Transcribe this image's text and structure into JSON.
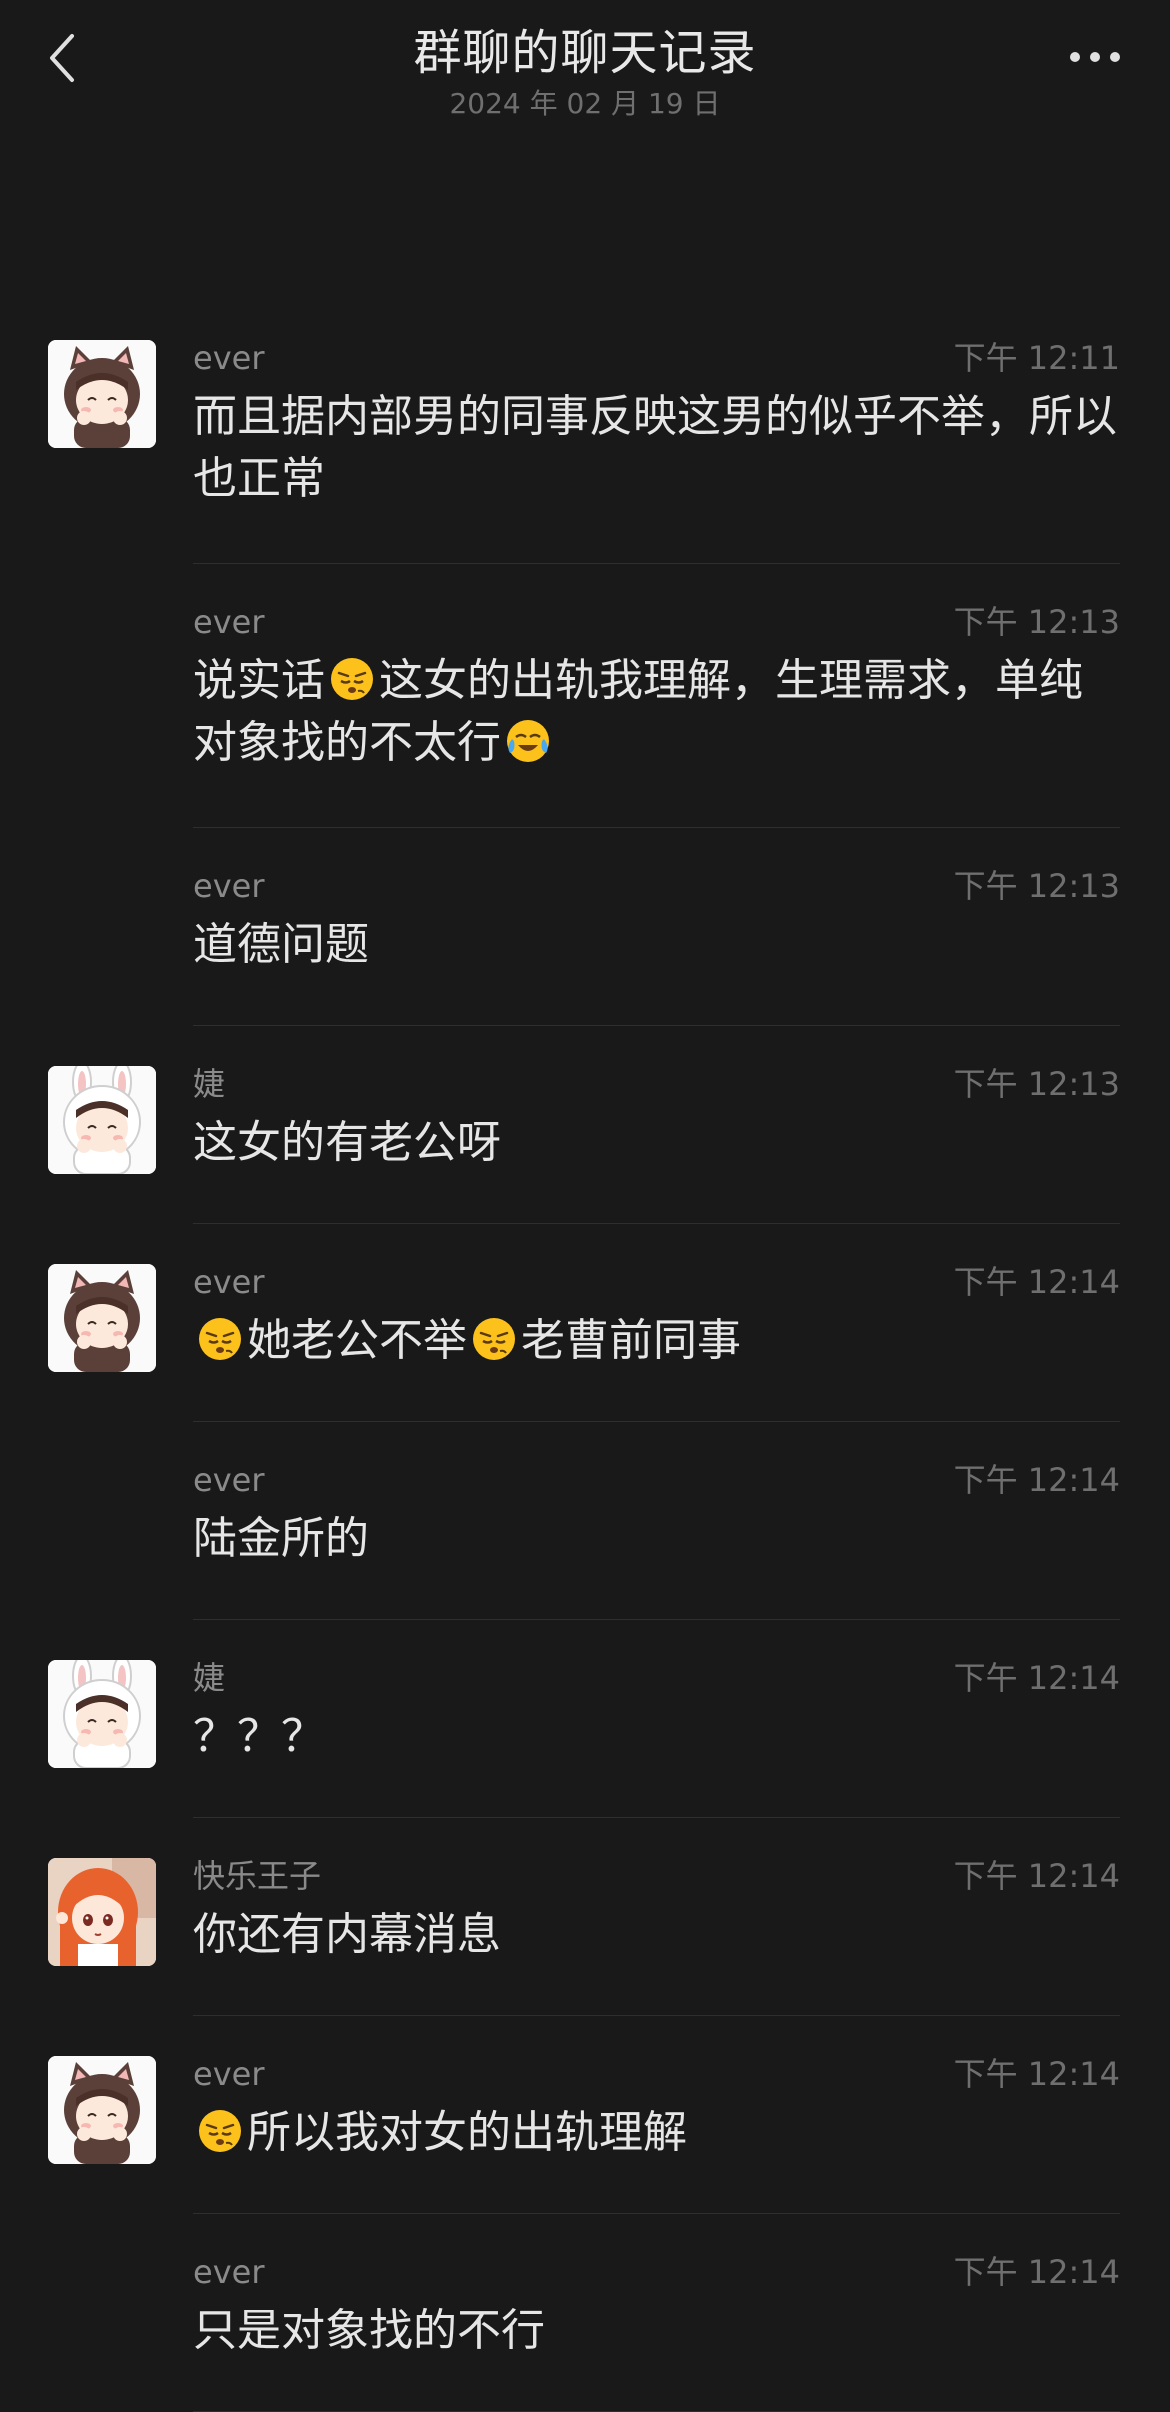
{
  "header": {
    "back_icon": "chevron-left-icon",
    "title": "群聊的聊天记录",
    "date": "2024 年 02 月 19 日",
    "more_icon": "ellipsis-icon"
  },
  "messages": [
    {
      "sender": "ever",
      "time": "下午 12:11",
      "avatar": "brown-cat-hood-avatar",
      "parts": [
        "而且据内部男的同事反映这男的似乎不举，所以也正常"
      ]
    },
    {
      "sender": "ever",
      "time": "下午 12:13",
      "avatar": "",
      "parts": [
        "说实话",
        "[emoji:sneer]",
        "这女的出轨我理解，生理需求，单纯对象找的不太行",
        "[emoji:tears]"
      ]
    },
    {
      "sender": "ever",
      "time": "下午 12:13",
      "avatar": "",
      "parts": [
        "道德问题"
      ]
    },
    {
      "sender": "婕",
      "time": "下午 12:13",
      "avatar": "white-bunny-hood-avatar",
      "parts": [
        "这女的有老公呀"
      ]
    },
    {
      "sender": "ever",
      "time": "下午 12:14",
      "avatar": "brown-cat-hood-avatar",
      "parts": [
        "[emoji:sneer]",
        "她老公不举",
        "[emoji:sneer]",
        "老曹前同事"
      ]
    },
    {
      "sender": "ever",
      "time": "下午 12:14",
      "avatar": "",
      "parts": [
        "陆金所的"
      ]
    },
    {
      "sender": "婕",
      "time": "下午 12:14",
      "avatar": "white-bunny-hood-avatar",
      "parts": [
        "？？？"
      ]
    },
    {
      "sender": "快乐王子",
      "time": "下午 12:14",
      "avatar": "orange-hair-anime-avatar",
      "parts": [
        "你还有内幕消息"
      ]
    },
    {
      "sender": "ever",
      "time": "下午 12:14",
      "avatar": "brown-cat-hood-avatar",
      "parts": [
        "[emoji:sneer]",
        "所以我对女的出轨理解"
      ]
    },
    {
      "sender": "ever",
      "time": "下午 12:14",
      "avatar": "",
      "parts": [
        "只是对象找的不行"
      ]
    }
  ],
  "colors": {
    "background": "#191919",
    "text": "#e6e6e6",
    "name": "#8a8a8a",
    "time": "#6f6f6f",
    "divider": "#2e2e2e"
  }
}
